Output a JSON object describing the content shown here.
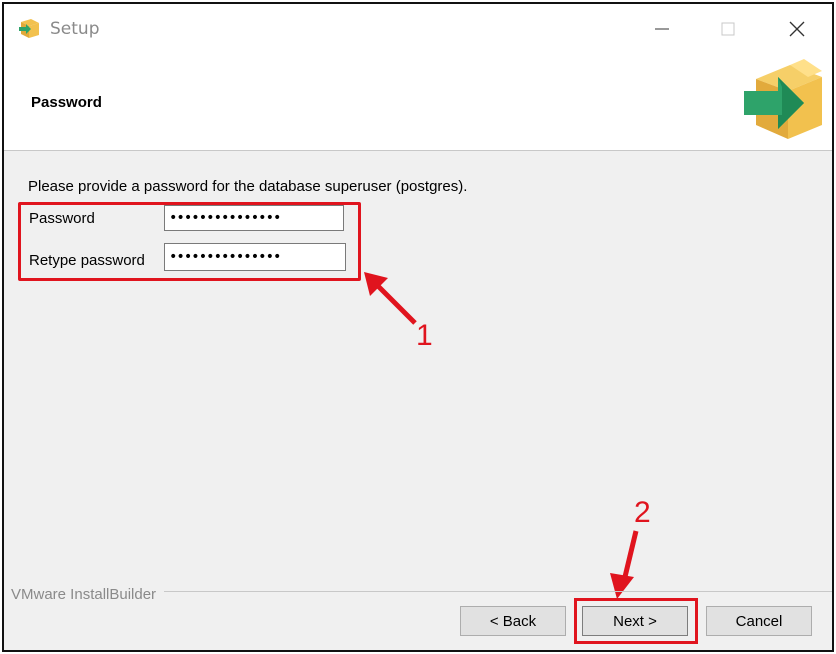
{
  "window": {
    "title": "Setup",
    "app_icon": "installer-box-icon",
    "controls": {
      "minimize": "minimize-icon",
      "maximize": "maximize-icon",
      "close": "close-icon"
    }
  },
  "header": {
    "title": "Password",
    "logo": "installer-box-icon"
  },
  "content": {
    "instruction": "Please provide a password for the database superuser (postgres).",
    "password": {
      "label": "Password",
      "value": "•••••••••••••••"
    },
    "retype_password": {
      "label": "Retype password",
      "value": "•••••••••••••••"
    }
  },
  "annotations": {
    "step1": "1",
    "step2": "2",
    "color": "#e0141e"
  },
  "footer": {
    "branding": "VMware InstallBuilder",
    "back_label": "< Back",
    "next_label": "Next >",
    "cancel_label": "Cancel"
  }
}
